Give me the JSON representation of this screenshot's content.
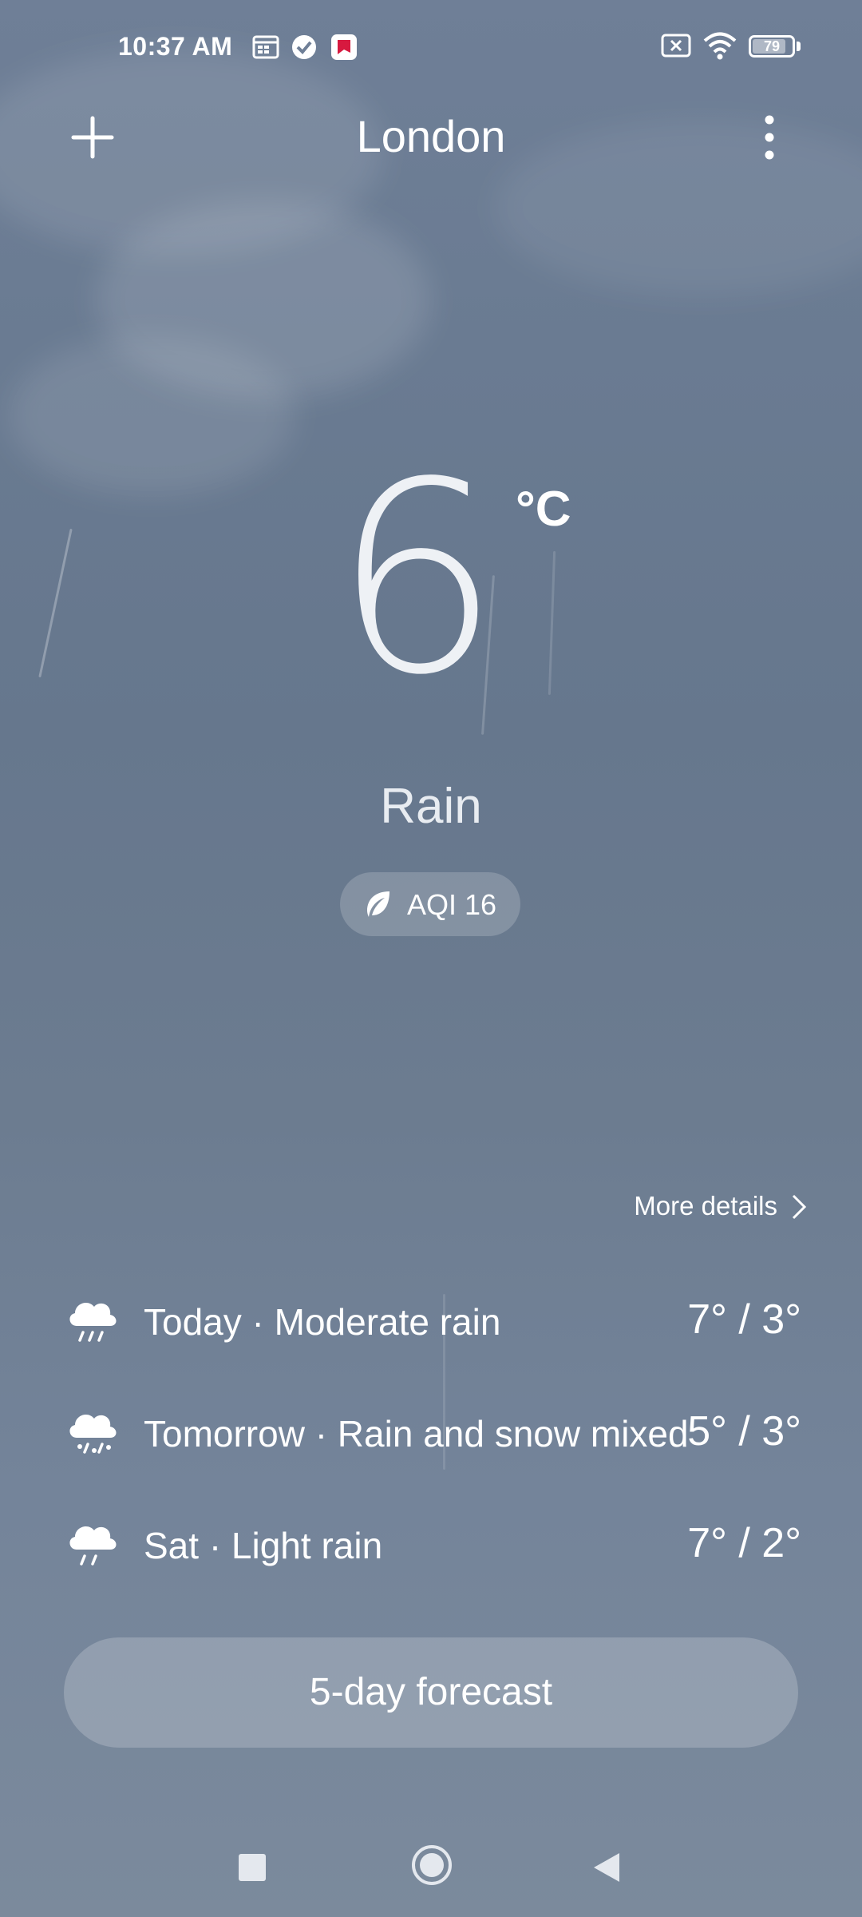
{
  "status_bar": {
    "time": "10:37 AM",
    "battery_level": "79",
    "icons": [
      "calendar-icon",
      "check-circle-icon",
      "app-notification-icon",
      "no-sim-icon",
      "wifi-icon",
      "battery-icon"
    ]
  },
  "header": {
    "city": "London",
    "add_icon": "plus-icon",
    "menu_icon": "more-vertical-icon"
  },
  "current": {
    "temperature": "6",
    "unit": "°C",
    "condition": "Rain",
    "aqi_label": "AQI 16",
    "aqi_icon": "leaf-icon"
  },
  "more_details": "More details",
  "forecast": [
    {
      "label": "Today · Moderate rain",
      "range": "7° / 3°",
      "icon": "rain-cloud-icon"
    },
    {
      "label": "Tomorrow · Rain and snow mixed",
      "range": "5° / 3°",
      "icon": "rain-snow-cloud-icon"
    },
    {
      "label": "Sat · Light rain",
      "range": "7° / 2°",
      "icon": "light-rain-cloud-icon"
    }
  ],
  "forecast_button": "5-day forecast",
  "navigation": [
    "recents-icon",
    "home-icon",
    "back-icon"
  ],
  "colors": {
    "background": "#6a7b92",
    "text": "#ffffff",
    "pill": "rgba(255,255,255,0.20)"
  }
}
